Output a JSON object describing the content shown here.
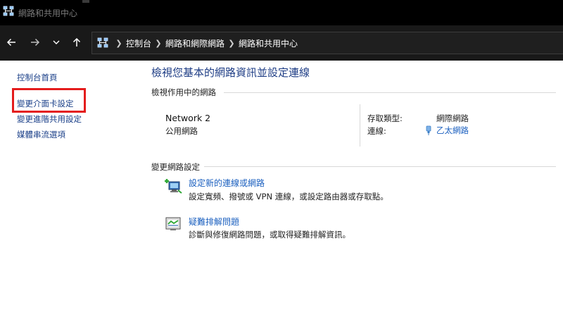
{
  "window": {
    "title": "網路和共用中心"
  },
  "nav": {
    "back_icon": "back-arrow-icon",
    "forward_icon": "forward-arrow-icon",
    "recent_icon": "chevron-down-icon",
    "up_icon": "up-arrow-icon",
    "breadcrumbs": [
      "控制台",
      "網路和網際網路",
      "網路和共用中心"
    ]
  },
  "sidebar": {
    "items": [
      {
        "label": "控制台首頁"
      },
      {
        "label": "變更介面卡設定"
      },
      {
        "label": "變更進階共用設定"
      },
      {
        "label": "媒體串流選項"
      }
    ],
    "highlight_color": "#e41c1c"
  },
  "main": {
    "title": "檢視您基本的網路資訊並設定連線",
    "active_networks_heading": "檢視作用中的網路",
    "network": {
      "name": "Network 2",
      "category": "公用網路",
      "access_type_label": "存取類型:",
      "access_type_value": "網際網路",
      "connections_label": "連線:",
      "connection_value": "乙太網路"
    },
    "change_settings_heading": "變更網路設定",
    "tasks": [
      {
        "link": "設定新的連線或網路",
        "desc": "設定寬頻、撥號或 VPN 連線，或設定路由器或存取點。",
        "icon": "new-connection-icon"
      },
      {
        "link": "疑難排解問題",
        "desc": "診斷與修復網路問題，或取得疑難排解資訊。",
        "icon": "troubleshoot-icon"
      }
    ]
  },
  "colors": {
    "link": "#1a5fbf",
    "title": "#1e3d85",
    "navbar_bg": "#191919",
    "titlebar_bg": "#000000"
  }
}
